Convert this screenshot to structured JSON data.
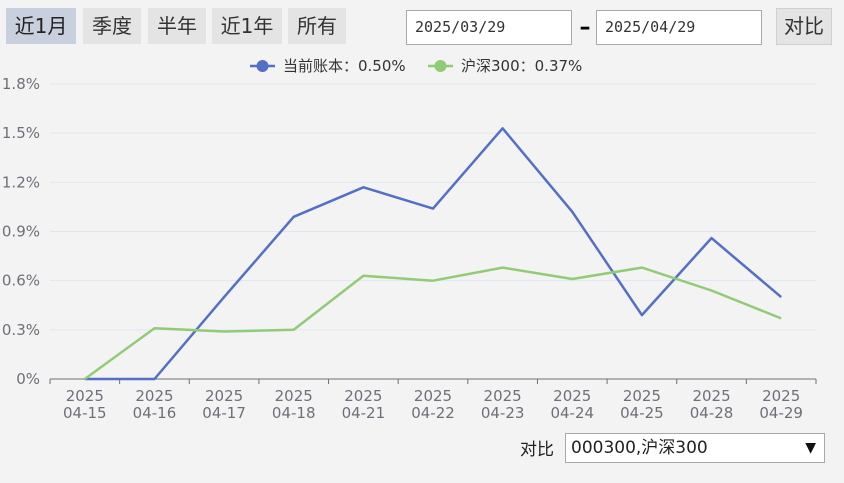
{
  "ranges": [
    {
      "label": "近1月",
      "active": true
    },
    {
      "label": "季度",
      "active": false
    },
    {
      "label": "半年",
      "active": false
    },
    {
      "label": "近1年",
      "active": false
    },
    {
      "label": "所有",
      "active": false
    }
  ],
  "date_range": {
    "start": "2025/03/29",
    "separator": "–",
    "end": "2025/04/29"
  },
  "compare_button": "对比",
  "compare_label": "对比",
  "compare_select": {
    "value": "000300,沪深300"
  },
  "colors": {
    "account": "#5470c6",
    "index": "#91cc75",
    "grid": "#e0e6f1",
    "axis": "#6e7079"
  },
  "chart_data": {
    "type": "line",
    "categories": [
      [
        "2025",
        "04-15"
      ],
      [
        "2025",
        "04-16"
      ],
      [
        "2025",
        "04-17"
      ],
      [
        "2025",
        "04-18"
      ],
      [
        "2025",
        "04-21"
      ],
      [
        "2025",
        "04-22"
      ],
      [
        "2025",
        "04-23"
      ],
      [
        "2025",
        "04-24"
      ],
      [
        "2025",
        "04-25"
      ],
      [
        "2025",
        "04-28"
      ],
      [
        "2025",
        "04-29"
      ]
    ],
    "ylim": [
      0,
      1.8
    ],
    "yticks": [
      "0%",
      "0.3%",
      "0.6%",
      "0.9%",
      "1.2%",
      "1.5%",
      "1.8%"
    ],
    "ytick_values": [
      0,
      0.3,
      0.6,
      0.9,
      1.2,
      1.5,
      1.8
    ],
    "grid": true,
    "legend_position": "top-center",
    "series": [
      {
        "name": "当前账本",
        "legend": "当前账本：0.50%",
        "color_key": "account",
        "values": [
          0,
          0,
          0.5,
          0.99,
          1.17,
          1.04,
          1.53,
          1.02,
          0.39,
          0.86,
          0.5
        ]
      },
      {
        "name": "沪深300",
        "legend": "沪深300：0.37%",
        "color_key": "index",
        "values": [
          0,
          0.31,
          0.29,
          0.3,
          0.63,
          0.6,
          0.68,
          0.61,
          0.68,
          0.54,
          0.37
        ]
      }
    ]
  }
}
